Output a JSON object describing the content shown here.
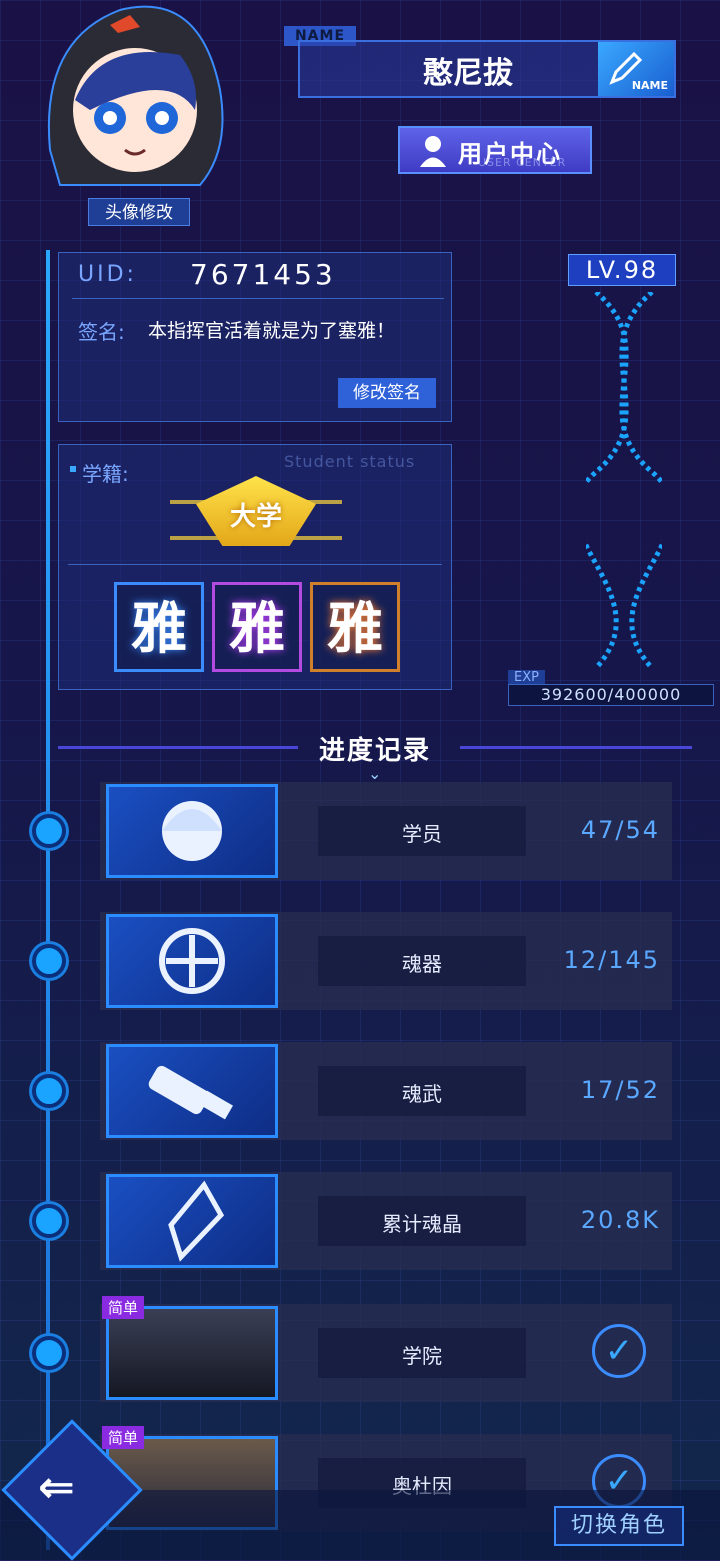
{
  "header": {
    "avatar_edit_label": "头像修改",
    "name_tag": "NAME",
    "player_name": "憨尼拔",
    "name_edit_label": "NAME",
    "user_center_label": "用户中心",
    "user_center_sub": "USER CENTER"
  },
  "profile": {
    "uid_label": "UID:",
    "uid_value": "7671453",
    "signature_label": "签名:",
    "signature_value": "本指挥官活着就是为了塞雅！",
    "edit_signature_label": "修改签名"
  },
  "student_status": {
    "label": "学籍:",
    "label_en": "Student status",
    "badge": "大学",
    "characters": [
      "雅",
      "雅",
      "雅"
    ]
  },
  "level": {
    "label": "LV.98",
    "exp_label": "EXP",
    "exp_value": "392600/400000",
    "exp_progress": 0.9815
  },
  "progress": {
    "title": "进度记录",
    "rows": [
      {
        "label": "学员",
        "value": "47/54"
      },
      {
        "label": "魂器",
        "value": "12/145"
      },
      {
        "label": "魂武",
        "value": "17/52"
      },
      {
        "label": "累计魂晶",
        "value": "20.8K"
      },
      {
        "label": "学院",
        "tag": "简单",
        "completed": true
      },
      {
        "label": "奥杜因",
        "tag": "简单",
        "completed": true
      }
    ]
  },
  "bottom": {
    "switch_role_label": "切换角色"
  },
  "colors": {
    "accent": "#2a8cff",
    "value": "#5aa8ff",
    "tag": "#8a2be2",
    "badge": "#ffd83a"
  }
}
